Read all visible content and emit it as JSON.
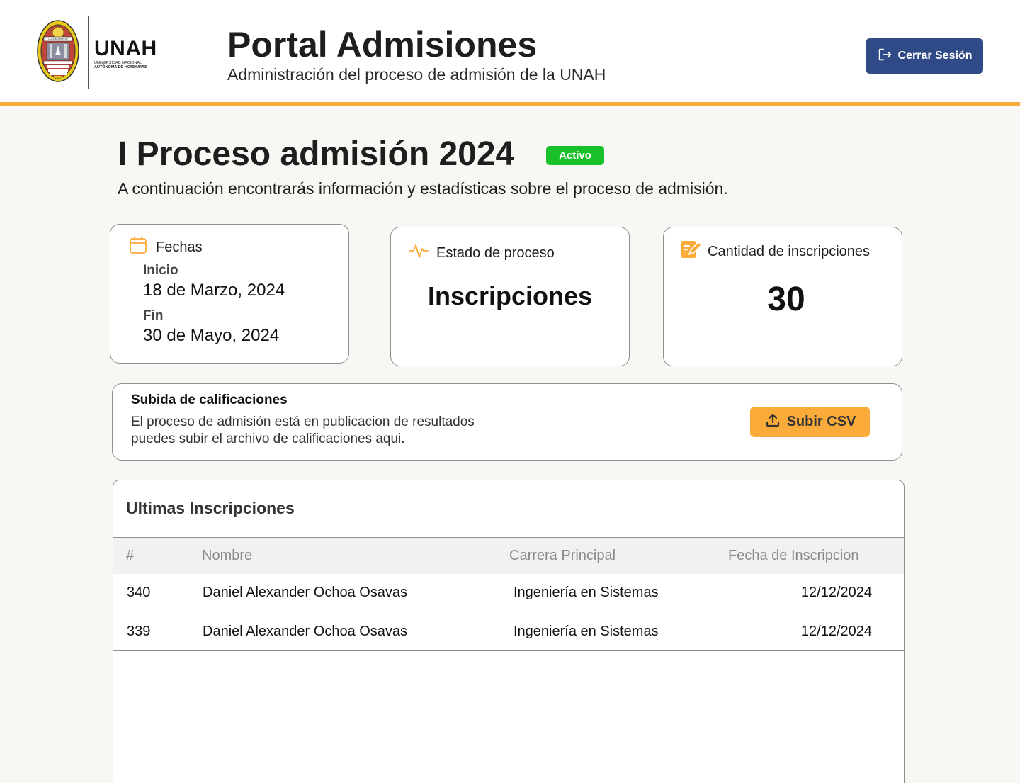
{
  "header": {
    "logo_text": "UNAH",
    "logo_sub_line1": "UNIVERSIDAD NACIONAL",
    "logo_sub_line2": "AUTÓNOMA DE HONDURAS",
    "seal_text_top": "LUCEM ASPICIO",
    "seal_year": "1847",
    "title": "Portal Admisiones",
    "subtitle": "Administración del proceso de admisión de la UNAH",
    "logout_label": "Cerrar Sesión"
  },
  "process": {
    "title": "I Proceso admisión 2024",
    "status_badge": "Activo",
    "description": "A continuación encontrarás información y estadísticas sobre el proceso de admisión."
  },
  "cards": {
    "fechas": {
      "title": "Fechas",
      "start_label": "Inicio",
      "start_value": "18 de Marzo, 2024",
      "end_label": "Fin",
      "end_value": "30 de Mayo, 2024"
    },
    "estado": {
      "title": "Estado de proceso",
      "value": "Inscripciones"
    },
    "cantidad": {
      "title": "Cantidad de inscripciones",
      "value": "30"
    }
  },
  "upload": {
    "title": "Subida de calificaciones",
    "desc_line1": "El proceso de admisión está en publicacion de resultados",
    "desc_line2": "puedes subir el archivo de calificaciones aqui.",
    "button_label": "Subir CSV"
  },
  "table": {
    "title": "Ultimas Inscripciones",
    "headers": [
      "#",
      "Nombre",
      "Carrera Principal",
      "Fecha de Inscripcion"
    ],
    "rows": [
      [
        "340",
        "Daniel Alexander Ochoa Osavas",
        "Ingeniería en Sistemas",
        "12/12/2024"
      ],
      [
        "339",
        "Daniel Alexander Ochoa Osavas",
        "Ingeniería en Sistemas",
        "12/12/2024"
      ]
    ]
  },
  "colors": {
    "accent": "#fbab3a",
    "primary": "#2f4a86",
    "active": "#18c12a",
    "background": "#f8f7f3"
  },
  "icons": {
    "logout": "logout-icon",
    "fechas": "calendar-icon",
    "estado": "activity-pulse-icon",
    "cantidad": "edit-note-icon",
    "upload": "upload-icon"
  }
}
